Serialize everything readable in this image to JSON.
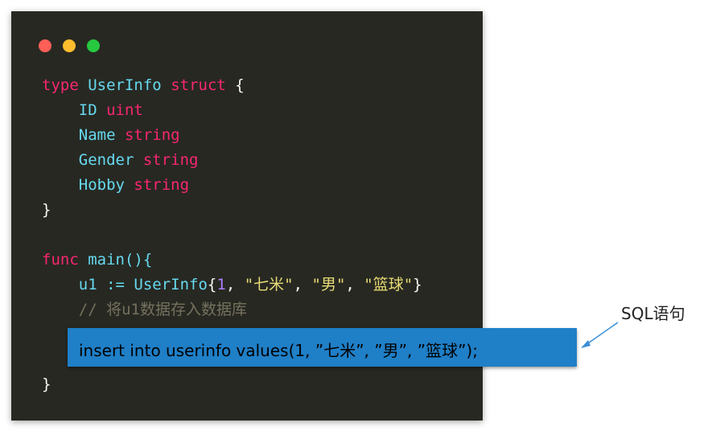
{
  "code": {
    "line1": {
      "kw1": "type",
      "name": "UserInfo",
      "kw2": "struct",
      "brace": "{"
    },
    "field1": {
      "name": "ID",
      "type": "uint"
    },
    "field2": {
      "name": "Name",
      "type": "string"
    },
    "field3": {
      "name": "Gender",
      "type": "string"
    },
    "field4": {
      "name": "Hobby",
      "type": "string"
    },
    "close1": "}",
    "func_line": {
      "kw": "func",
      "name": "main(){"
    },
    "assign_line": {
      "lhs": "u1 := ",
      "type": "UserInfo",
      "open": "{",
      "num": "1",
      "sep1": ", ",
      "s1": "\"七米\"",
      "sep2": ", ",
      "s2": "\"男\"",
      "sep3": ", ",
      "s3": "\"篮球\"",
      "close": "}"
    },
    "comment": "// 将u1数据存入数据库",
    "close2": "}"
  },
  "sql": {
    "statement": "insert into userinfo values(1, ”七米”, ”男”, ”篮球”);",
    "label": "SQL语句"
  },
  "colors": {
    "keyword": "#f92672",
    "identifier": "#66d9ef",
    "string": "#e6db74",
    "number": "#ae81ff",
    "comment": "#75715e",
    "sql_box": "#1f7fc7"
  }
}
